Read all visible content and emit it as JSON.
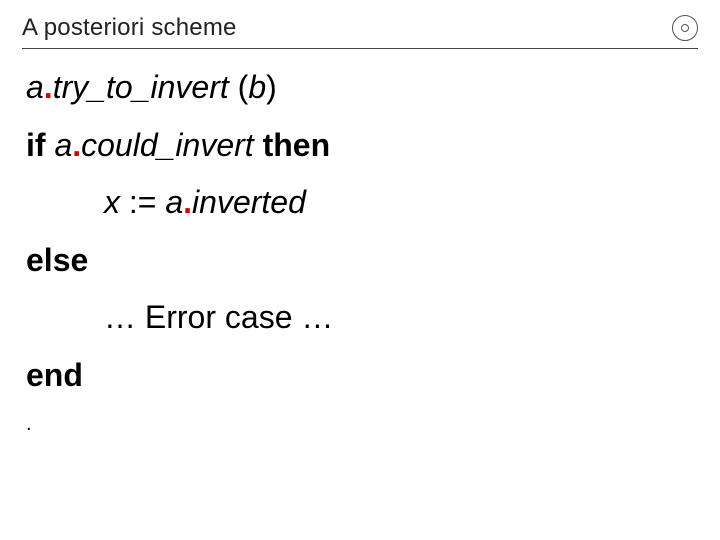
{
  "title": "A posteriori scheme",
  "code": {
    "a": "a",
    "try_to_invert": "try_to_invert",
    "b": "b",
    "if": "if",
    "could_invert": "could_invert",
    "then": "then",
    "x": "x",
    "assign": ":=",
    "inverted": "inverted",
    "else": "else",
    "error_case": "… Error case …",
    "end": "end",
    "dots": "…",
    "lparen": "(",
    "rparen": ")"
  },
  "logo_name": "eth-logo"
}
